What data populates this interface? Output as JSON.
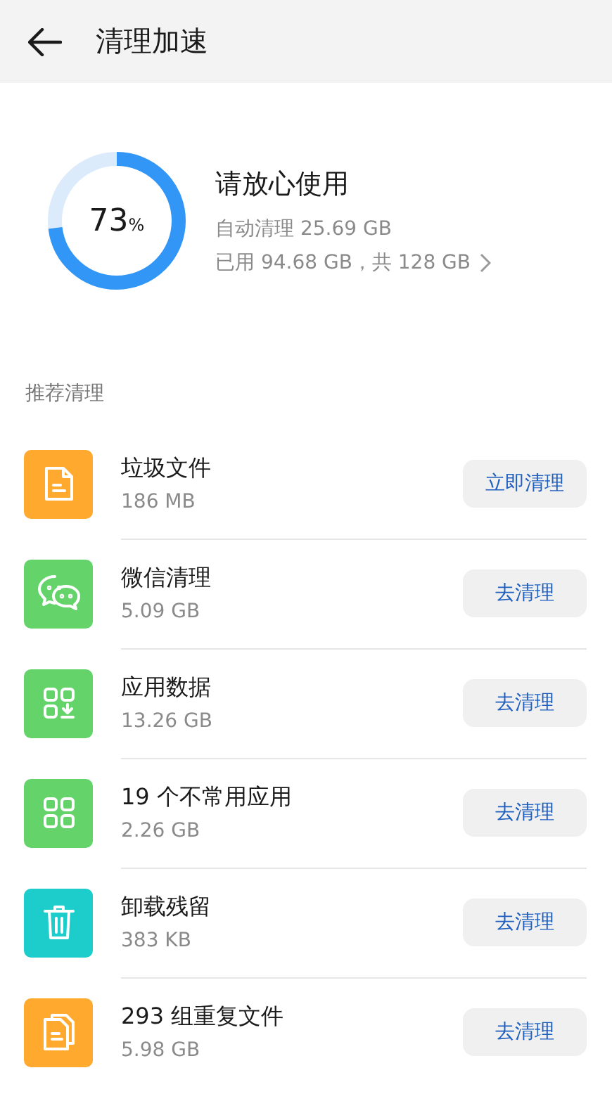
{
  "header": {
    "title": "清理加速"
  },
  "summary": {
    "percent": "73",
    "percent_sign": "%",
    "level": 0.73,
    "status": "请放心使用",
    "auto_clean": "自动清理 25.69 GB",
    "usage": "已用 94.68 GB，共 128 GB"
  },
  "section": {
    "title": "推荐清理"
  },
  "items": [
    {
      "kind": "file",
      "color": "#ffa92f",
      "title": "垃圾文件",
      "size": "186 MB",
      "action": "立即清理"
    },
    {
      "kind": "chat",
      "color": "#64d46a",
      "title": "微信清理",
      "size": "5.09 GB",
      "action": "去清理"
    },
    {
      "kind": "app-data",
      "color": "#64d46a",
      "title": "应用数据",
      "size": "13.26 GB",
      "action": "去清理"
    },
    {
      "kind": "apps",
      "color": "#64d46a",
      "title": "19 个不常用应用",
      "size": "2.26 GB",
      "action": "去清理"
    },
    {
      "kind": "trash",
      "color": "#1ccdcb",
      "title": "卸载残留",
      "size": "383 KB",
      "action": "去清理"
    },
    {
      "kind": "files",
      "color": "#ffa92f",
      "title": "293 组重复文件",
      "size": "5.98 GB",
      "action": "去清理"
    }
  ]
}
